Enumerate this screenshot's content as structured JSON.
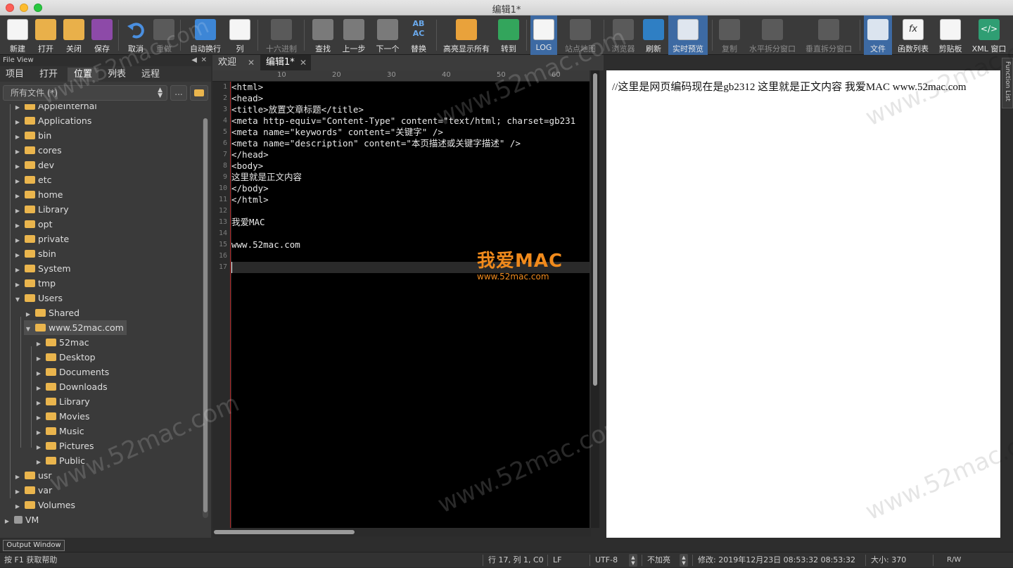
{
  "window": {
    "title": "编辑1*"
  },
  "toolbar": {
    "new": "新建",
    "open": "打开",
    "close": "关闭",
    "save": "保存",
    "undo": "取消",
    "redo": "重做",
    "wrap": "自动换行",
    "column": "列",
    "hex": "十六进制",
    "find": "查找",
    "prev": "上一步",
    "next": "下一个",
    "replace": "替换",
    "highlight_all": "高亮显示所有",
    "goto": "转到",
    "log": "LOG",
    "sitemap": "站点地图",
    "browser": "浏览器",
    "refresh": "刷新",
    "live_preview": "实时预览",
    "copy": "复制",
    "hsplit": "水平拆分窗口",
    "vsplit": "垂直拆分窗口",
    "file": "文件",
    "functions": "函数列表",
    "clipboard": "剪贴板",
    "xml": "XML 窗口",
    "xml_icon": "</>"
  },
  "left_pane": {
    "header": "File View",
    "tabs": [
      "项目",
      "打开",
      "位置",
      "列表",
      "远程"
    ],
    "location": "所有文件 (*)",
    "dots": "...",
    "tree": [
      "AppleInternal",
      "Applications",
      "bin",
      "cores",
      "dev",
      "etc",
      "home",
      "Library",
      "opt",
      "private",
      "sbin",
      "System",
      "tmp",
      "Users",
      "Shared",
      "www.52mac.com",
      "52mac",
      "Desktop",
      "Documents",
      "Downloads",
      "Library",
      "Movies",
      "Music",
      "Pictures",
      "Public",
      "usr",
      "var",
      "Volumes",
      "VM"
    ]
  },
  "editor": {
    "tabs": [
      "欢迎",
      "编辑1*"
    ],
    "ruler": [
      "10",
      "20",
      "30",
      "40",
      "50",
      "60"
    ],
    "lines": [
      "<html>",
      "<head>",
      "<title>放置文章标题</title>",
      "<meta http-equiv=\"Content-Type\" content=\"text/html; charset=gb231",
      "<meta name=\"keywords\" content=\"关键字\" />",
      "<meta name=\"description\" content=\"本页描述或关键字描述\" />",
      "</head>",
      "<body>",
      "这里就是正文内容",
      "</body>",
      "</html>",
      "",
      "我爱MAC",
      "",
      "www.52mac.com",
      "",
      ""
    ],
    "line_numbers": [
      "1",
      "2",
      "3",
      "4",
      "5",
      "6",
      "7",
      "8",
      "9",
      "10",
      "11",
      "12",
      "13",
      "14",
      "15",
      "16",
      "17"
    ]
  },
  "logo": {
    "big": "我爱MAC",
    "small": "www.52mac.com"
  },
  "preview": {
    "text": "//这里是网页编码现在是gb2312 这里就是正文内容 我爱MAC www.52mac.com"
  },
  "function_list": "Function List",
  "output_window": "Output Window",
  "watermark": "www.52mac.com",
  "status": {
    "help": "按 F1 获取帮助",
    "position": "行 17, 列 1, C0",
    "eol": "LF",
    "encoding": "UTF-8",
    "highlight": "不加亮",
    "modified": "修改: 2019年12月23日 08:53:32 08:53:32",
    "size": "大小: 370",
    "rw": "R/W"
  },
  "colors": {
    "accent": "#3d6aa3",
    "logo": "#f08a1c",
    "folder": "#eab54d"
  }
}
